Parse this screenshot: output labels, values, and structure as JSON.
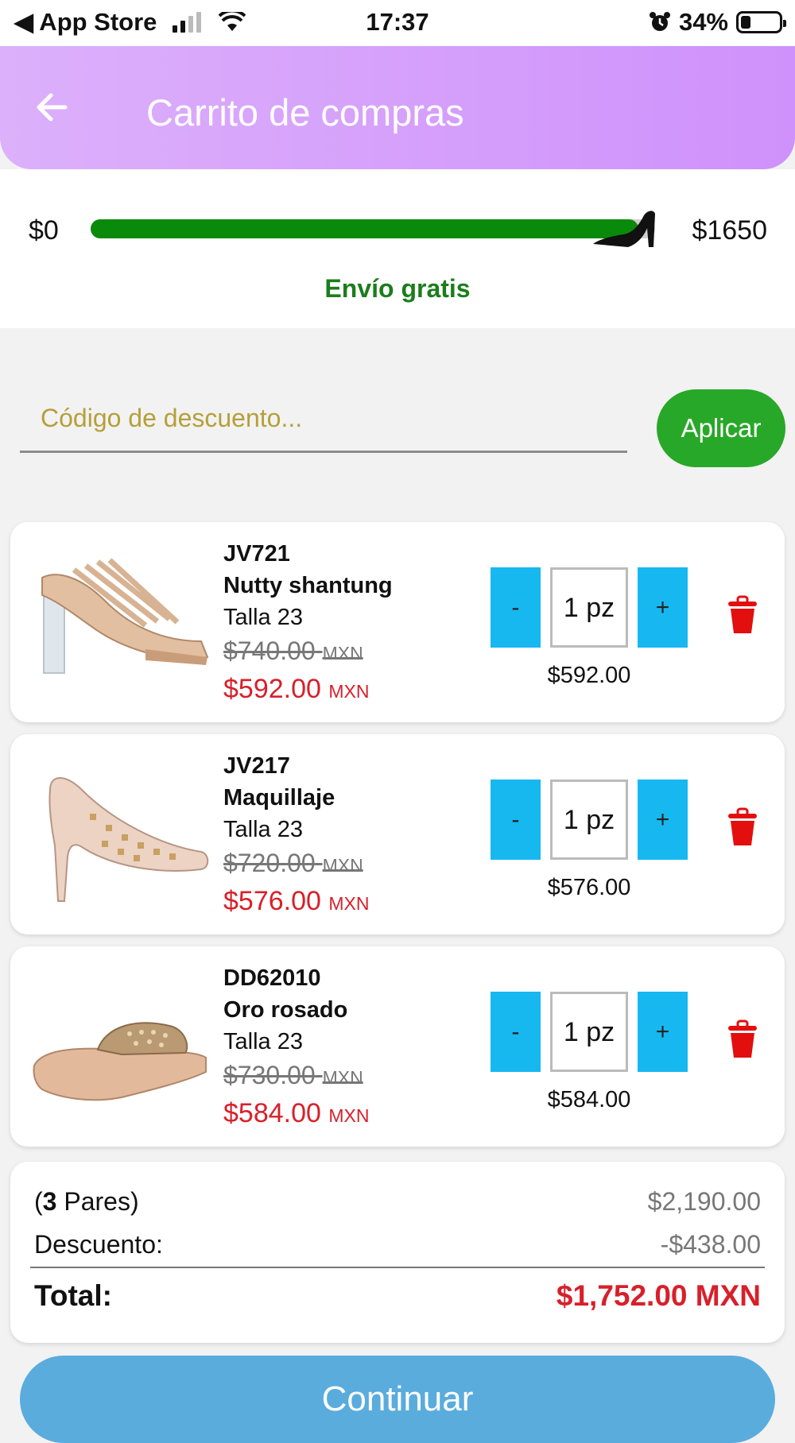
{
  "status_bar": {
    "back_label": "◀ App Store",
    "time": "17:37",
    "battery": "34%",
    "battery_level": 0.34
  },
  "header": {
    "title": "Carrito de compras"
  },
  "shipping_progress": {
    "min_label": "$0",
    "max_label": "$1650",
    "progress": 0.97,
    "message": "Envío gratis",
    "color": "#0a8a0a"
  },
  "discount": {
    "placeholder": "Código de descuento...",
    "apply_label": "Aplicar"
  },
  "items": [
    {
      "code": "JV721",
      "name": "Nutty shantung",
      "size": "Talla 23",
      "old_price": "$740.00",
      "new_price": "$592.00",
      "currency": "MXN",
      "qty": "1 pz",
      "minus": "-",
      "plus": "+",
      "line_total": "$592.00"
    },
    {
      "code": "JV217",
      "name": "Maquillaje",
      "size": "Talla 23",
      "old_price": "$720.00",
      "new_price": "$576.00",
      "currency": "MXN",
      "qty": "1 pz",
      "minus": "-",
      "plus": "+",
      "line_total": "$576.00"
    },
    {
      "code": "DD62010",
      "name": "Oro rosado",
      "size": "Talla 23",
      "old_price": "$730.00",
      "new_price": "$584.00",
      "currency": "MXN",
      "qty": "1 pz",
      "minus": "-",
      "plus": "+",
      "line_total": "$584.00"
    }
  ],
  "summary": {
    "pairs_open": "(",
    "pairs_count": "3",
    "pairs_label": " Pares)",
    "subtotal": "$2,190.00",
    "discount_label": "Descuento:",
    "discount_value": "-$438.00",
    "total_label": "Total:",
    "total_value": "$1,752.00 MXN"
  },
  "continue_label": "Continuar"
}
